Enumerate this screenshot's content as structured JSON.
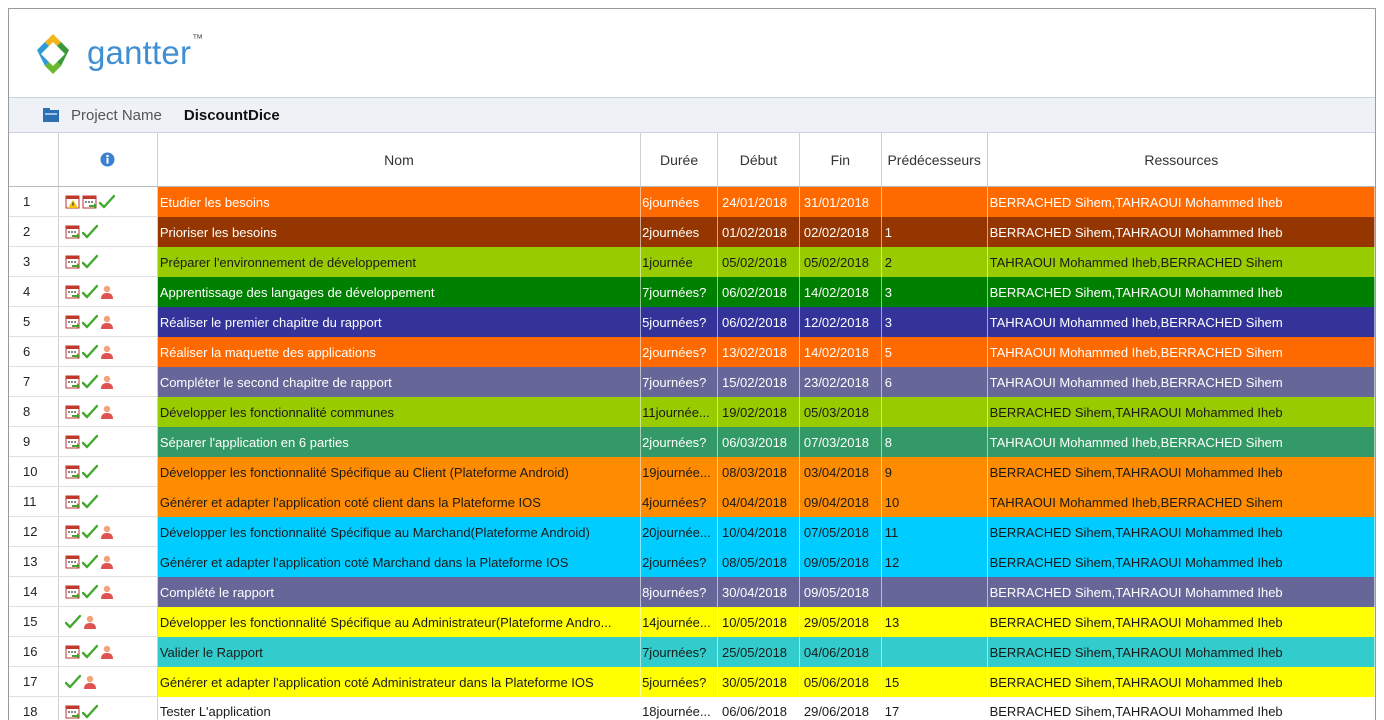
{
  "app": {
    "name": "gantter",
    "trademark": "™"
  },
  "project": {
    "label": "Project Name",
    "name": "DiscountDice"
  },
  "columns": {
    "info_icon": "info-icon",
    "nom": "Nom",
    "duree": "Durée",
    "debut": "Début",
    "fin": "Fin",
    "predecesseurs": "Prédécesseurs",
    "ressources": "Ressources"
  },
  "tasks": [
    {
      "id": "1",
      "nom": "Etudier les besoins",
      "duree": "6journées",
      "debut": "24/01/2018",
      "fin": "31/01/2018",
      "pred": "",
      "res": "BERRACHED Sihem,TAHRAOUI Mohammed Iheb",
      "bg": "#ff6a00",
      "fg": "#ffffff",
      "icons": [
        "calendar-warning-icon",
        "calendar-icon",
        "check-icon"
      ]
    },
    {
      "id": "2",
      "nom": "Prioriser les besoins",
      "duree": "2journées",
      "debut": "01/02/2018",
      "fin": "02/02/2018",
      "pred": "1",
      "res": "BERRACHED Sihem,TAHRAOUI Mohammed Iheb",
      "bg": "#953600",
      "fg": "#ffffff",
      "icons": [
        "calendar-icon",
        "check-icon"
      ]
    },
    {
      "id": "3",
      "nom": "Préparer l'environnement de développement",
      "duree": "1journée",
      "debut": "05/02/2018",
      "fin": "05/02/2018",
      "pred": "2",
      "res": "TAHRAOUI Mohammed Iheb,BERRACHED Sihem",
      "bg": "#99cc00",
      "fg": "#1a1a1a",
      "icons": [
        "calendar-icon",
        "check-icon"
      ]
    },
    {
      "id": "4",
      "nom": "Apprentissage des langages de développement",
      "duree": "7journées?",
      "debut": "06/02/2018",
      "fin": "14/02/2018",
      "pred": "3",
      "res": "BERRACHED Sihem,TAHRAOUI Mohammed Iheb",
      "bg": "#008000",
      "fg": "#ffffff",
      "icons": [
        "calendar-icon",
        "check-icon",
        "user-icon"
      ]
    },
    {
      "id": "5",
      "nom": "Réaliser le premier chapitre du rapport",
      "duree": "5journées?",
      "debut": "06/02/2018",
      "fin": "12/02/2018",
      "pred": "3",
      "res": "TAHRAOUI Mohammed Iheb,BERRACHED Sihem",
      "bg": "#333399",
      "fg": "#ffffff",
      "icons": [
        "calendar-icon",
        "check-icon",
        "user-icon"
      ]
    },
    {
      "id": "6",
      "nom": "Réaliser la maquette des applications",
      "duree": "2journées?",
      "debut": "13/02/2018",
      "fin": "14/02/2018",
      "pred": "5",
      "res": "TAHRAOUI Mohammed Iheb,BERRACHED Sihem",
      "bg": "#ff6a00",
      "fg": "#ffffff",
      "icons": [
        "calendar-icon",
        "check-icon",
        "user-icon"
      ]
    },
    {
      "id": "7",
      "nom": "Compléter le second chapitre de rapport",
      "duree": "7journées?",
      "debut": "15/02/2018",
      "fin": "23/02/2018",
      "pred": "6",
      "res": "TAHRAOUI Mohammed Iheb,BERRACHED Sihem",
      "bg": "#666699",
      "fg": "#ffffff",
      "icons": [
        "calendar-icon",
        "check-icon",
        "user-icon"
      ]
    },
    {
      "id": "8",
      "nom": "Développer les fonctionnalité communes",
      "duree": "11journée...",
      "debut": "19/02/2018",
      "fin": "05/03/2018",
      "pred": "",
      "res": "BERRACHED Sihem,TAHRAOUI Mohammed Iheb",
      "bg": "#99cc00",
      "fg": "#1a1a1a",
      "icons": [
        "calendar-icon",
        "check-icon",
        "user-icon"
      ]
    },
    {
      "id": "9",
      "nom": "Séparer l'application en 6 parties",
      "duree": "2journées?",
      "debut": "06/03/2018",
      "fin": "07/03/2018",
      "pred": "8",
      "res": "TAHRAOUI Mohammed Iheb,BERRACHED Sihem",
      "bg": "#339966",
      "fg": "#ffffff",
      "icons": [
        "calendar-icon",
        "check-icon"
      ]
    },
    {
      "id": "10",
      "nom": "Développer les fonctionnalité Spécifique au Client (Plateforme Android)",
      "duree": "19journée...",
      "debut": "08/03/2018",
      "fin": "03/04/2018",
      "pred": "9",
      "res": "BERRACHED Sihem,TAHRAOUI Mohammed Iheb",
      "bg": "#ff8c00",
      "fg": "#1a1a1a",
      "icons": [
        "calendar-icon",
        "check-icon"
      ]
    },
    {
      "id": "11",
      "nom": "Générer et adapter l'application coté client dans la Plateforme IOS",
      "duree": "4journées?",
      "debut": "04/04/2018",
      "fin": "09/04/2018",
      "pred": "10",
      "res": "TAHRAOUI Mohammed Iheb,BERRACHED Sihem",
      "bg": "#ff8c00",
      "fg": "#1a1a1a",
      "icons": [
        "calendar-icon",
        "check-icon"
      ]
    },
    {
      "id": "12",
      "nom": "Développer les fonctionnalité Spécifique au Marchand(Plateforme Android)",
      "duree": "20journée...",
      "debut": "10/04/2018",
      "fin": "07/05/2018",
      "pred": "11",
      "res": "BERRACHED Sihem,TAHRAOUI Mohammed Iheb",
      "bg": "#00ccff",
      "fg": "#1a1a1a",
      "icons": [
        "calendar-icon",
        "check-icon",
        "user-icon"
      ]
    },
    {
      "id": "13",
      "nom": "Générer et adapter l'application coté Marchand dans la Plateforme IOS",
      "duree": "2journées?",
      "debut": "08/05/2018",
      "fin": "09/05/2018",
      "pred": "12",
      "res": "BERRACHED Sihem,TAHRAOUI Mohammed Iheb",
      "bg": "#00ccff",
      "fg": "#1a1a1a",
      "icons": [
        "calendar-icon",
        "check-icon",
        "user-icon"
      ]
    },
    {
      "id": "14",
      "nom": "Complété le rapport",
      "duree": "8journées?",
      "debut": "30/04/2018",
      "fin": "09/05/2018",
      "pred": "",
      "res": "BERRACHED Sihem,TAHRAOUI Mohammed Iheb",
      "bg": "#666699",
      "fg": "#ffffff",
      "icons": [
        "calendar-icon",
        "check-icon",
        "user-icon"
      ]
    },
    {
      "id": "15",
      "nom": "Développer les fonctionnalité Spécifique au Administrateur(Plateforme Andro...",
      "duree": "14journée...",
      "debut": "10/05/2018",
      "fin": "29/05/2018",
      "pred": "13",
      "res": "BERRACHED Sihem,TAHRAOUI Mohammed Iheb",
      "bg": "#ffff00",
      "fg": "#1a1a1a",
      "icons": [
        "check-icon",
        "user-icon"
      ]
    },
    {
      "id": "16",
      "nom": "Valider le Rapport",
      "duree": "7journées?",
      "debut": "25/05/2018",
      "fin": "04/06/2018",
      "pred": "",
      "res": "BERRACHED Sihem,TAHRAOUI Mohammed Iheb",
      "bg": "#33cccc",
      "fg": "#1a1a1a",
      "icons": [
        "calendar-icon",
        "check-icon",
        "user-icon"
      ]
    },
    {
      "id": "17",
      "nom": "Générer et adapter l'application coté Administrateur dans la Plateforme IOS",
      "duree": "5journées?",
      "debut": "30/05/2018",
      "fin": "05/06/2018",
      "pred": "15",
      "res": "BERRACHED Sihem,TAHRAOUI Mohammed Iheb",
      "bg": "#ffff00",
      "fg": "#1a1a1a",
      "icons": [
        "check-icon",
        "user-icon"
      ]
    },
    {
      "id": "18",
      "nom": "Tester L'application",
      "duree": "18journée...",
      "debut": "06/06/2018",
      "fin": "29/06/2018",
      "pred": "17",
      "res": "BERRACHED Sihem,TAHRAOUI Mohammed Iheb",
      "bg": "#ffffff",
      "fg": "#1a1a1a",
      "icons": [
        "calendar-icon",
        "check-icon"
      ]
    }
  ]
}
